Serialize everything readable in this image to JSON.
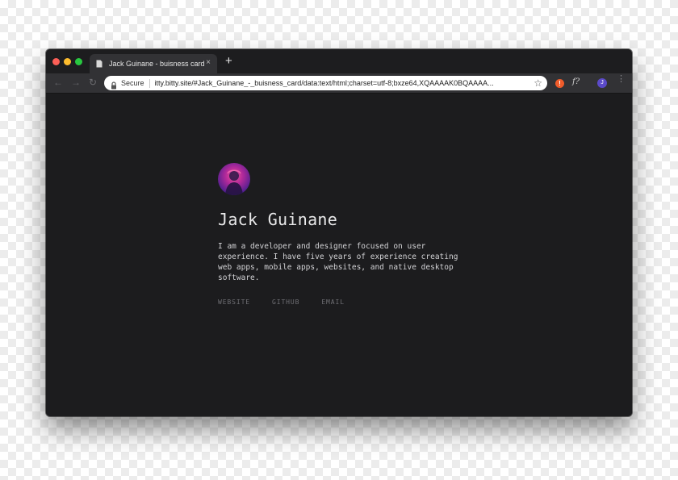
{
  "browser": {
    "tab": {
      "title": "Jack Guinane - buisness card",
      "close_glyph": "×",
      "icon": "document-icon"
    },
    "new_tab_glyph": "+",
    "nav": {
      "back_glyph": "←",
      "forward_glyph": "→",
      "reload_glyph": "↻"
    },
    "omnibox": {
      "security_label": "Secure",
      "url": "itty.bitty.site/#Jack_Guinane_-_buisness_card/data:text/html;charset=utf-8;bxze64,XQAAAAK0BQAAAA..."
    },
    "bookmark_glyph": "☆",
    "extensions": {
      "alert_glyph": "!",
      "fx_label": "f?"
    },
    "profile_initial": "J",
    "menu_glyph": "⋮"
  },
  "profile": {
    "name": "Jack Guinane",
    "bio": "I am a developer and designer focused on user experience. I have five years of experience creating web apps, mobile apps, websites, and native desktop software.",
    "links": [
      {
        "label": "WEBSITE"
      },
      {
        "label": "GITHUB"
      },
      {
        "label": "EMAIL"
      }
    ]
  },
  "colors": {
    "page_background": "#1c1c1e",
    "toolbar": "#323235",
    "accent_avatar": "#b0299a"
  }
}
